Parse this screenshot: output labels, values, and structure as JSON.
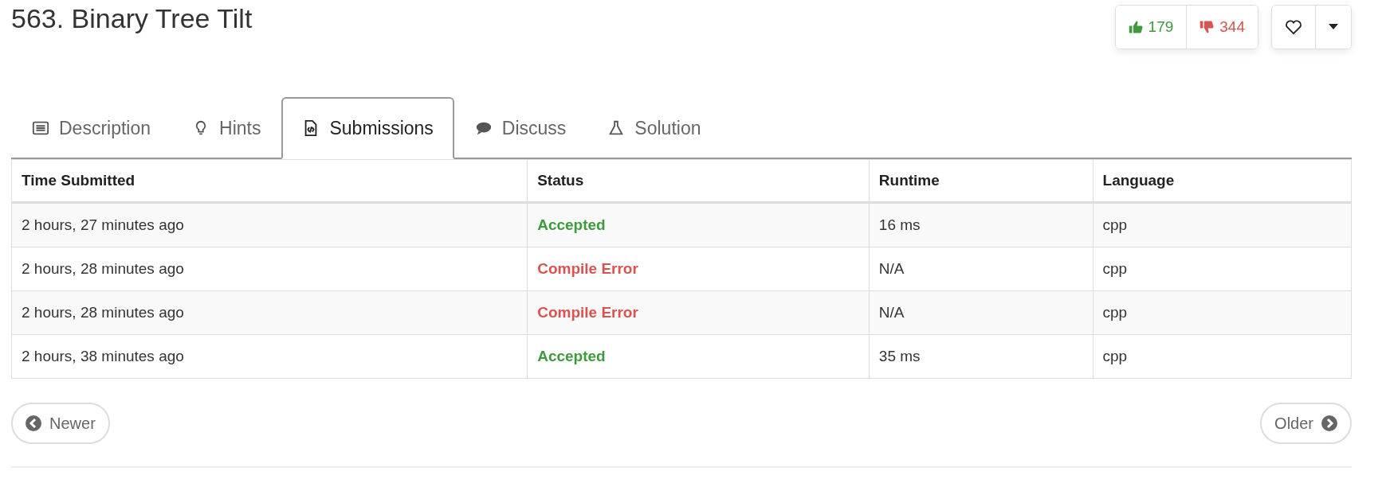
{
  "title": "563. Binary Tree Tilt",
  "votes": {
    "up": "179",
    "down": "344"
  },
  "tabs": [
    {
      "label": "Description",
      "kind": "list",
      "selected": false
    },
    {
      "label": "Hints",
      "kind": "bulb",
      "selected": false
    },
    {
      "label": "Submissions",
      "kind": "code",
      "selected": true
    },
    {
      "label": "Discuss",
      "kind": "chat",
      "selected": false
    },
    {
      "label": "Solution",
      "kind": "flask",
      "selected": false
    }
  ],
  "table": {
    "columns": [
      "Time Submitted",
      "Status",
      "Runtime",
      "Language"
    ],
    "rows": [
      {
        "time": "2 hours, 27 minutes ago",
        "status": "Accepted",
        "kind": "accepted",
        "runtime": "16 ms",
        "language": "cpp"
      },
      {
        "time": "2 hours, 28 minutes ago",
        "status": "Compile Error",
        "kind": "error",
        "runtime": "N/A",
        "language": "cpp"
      },
      {
        "time": "2 hours, 28 minutes ago",
        "status": "Compile Error",
        "kind": "error",
        "runtime": "N/A",
        "language": "cpp"
      },
      {
        "time": "2 hours, 38 minutes ago",
        "status": "Accepted",
        "kind": "accepted",
        "runtime": "35 ms",
        "language": "cpp"
      }
    ]
  },
  "pager": {
    "newer": "Newer",
    "older": "Older"
  }
}
